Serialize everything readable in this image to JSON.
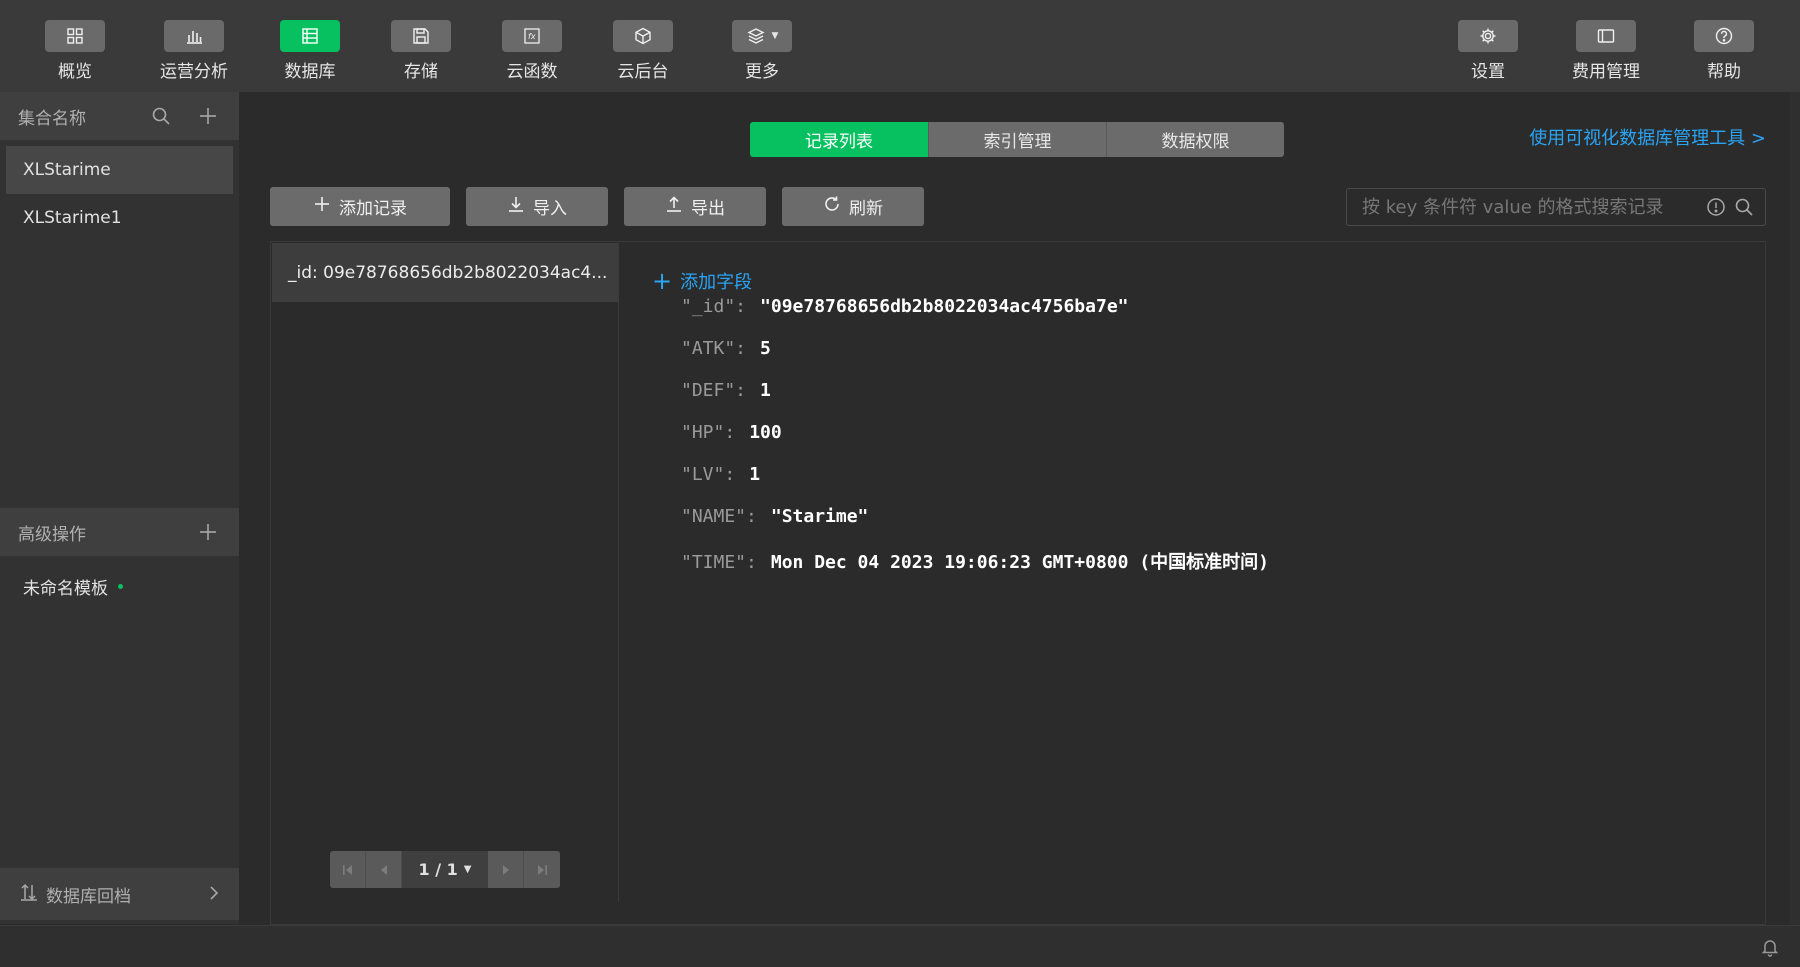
{
  "toolbar": {
    "items": [
      {
        "label": "概览",
        "icon": "grid-icon"
      },
      {
        "label": "运营分析",
        "icon": "bar-chart-icon"
      },
      {
        "label": "数据库",
        "icon": "database-table-icon"
      },
      {
        "label": "存储",
        "icon": "save-icon"
      },
      {
        "label": "云函数",
        "icon": "function-icon"
      },
      {
        "label": "云后台",
        "icon": "cube-icon"
      },
      {
        "label": "更多",
        "icon": "layers-icon"
      },
      {
        "label": "设置",
        "icon": "gear-icon"
      },
      {
        "label": "费用管理",
        "icon": "billing-icon"
      },
      {
        "label": "帮助",
        "icon": "help-icon"
      }
    ],
    "active_label": "数据库"
  },
  "sidebar": {
    "collections_header": "集合名称",
    "collections": [
      "XLStarime",
      "XLStarime1"
    ],
    "selected_collection": "XLStarime",
    "advanced_header": "高级操作",
    "templates": [
      "未命名模板"
    ],
    "footer_label": "数据库回档"
  },
  "main": {
    "tabs": [
      "记录列表",
      "索引管理",
      "数据权限"
    ],
    "active_tab": "记录列表",
    "viz_link": "使用可视化数据库管理工具 >",
    "actions": {
      "add": "添加记录",
      "import": "导入",
      "export": "导出",
      "refresh": "刷新"
    },
    "search_placeholder": "按 key 条件符 value 的格式搜索记录",
    "records": [
      "_id: 09e78768656db2b8022034ac4..."
    ],
    "pager": "1 / 1",
    "add_field": "添加字段",
    "fields": [
      {
        "key": "\"_id\":",
        "value": "\"09e78768656db2b8022034ac4756ba7e\""
      },
      {
        "key": "\"ATK\":",
        "value": "5"
      },
      {
        "key": "\"DEF\":",
        "value": "1"
      },
      {
        "key": "\"HP\":",
        "value": "100"
      },
      {
        "key": "\"LV\":",
        "value": "1"
      },
      {
        "key": "\"NAME\":",
        "value": "\"Starime\""
      },
      {
        "key": "\"TIME\":",
        "value": "Mon Dec 04 2023 19:06:23 GMT+0800 (中国标准时间)"
      }
    ]
  },
  "colors": {
    "accent_green": "#07c160",
    "link_blue": "#2aa4f4"
  }
}
